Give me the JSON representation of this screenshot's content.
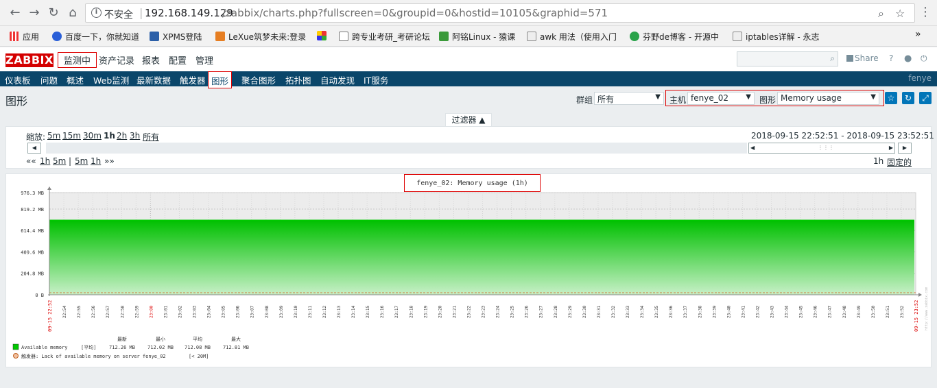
{
  "browser": {
    "back_icon": "←",
    "forward_icon": "→",
    "reload_icon": "↻",
    "home_icon": "⌂",
    "insecure_label": "不安全",
    "url_host": "192.168.149.129",
    "url_path": "/zabbix/charts.php?fullscreen=0&groupid=0&hostid=10105&graphid=571",
    "bookmarks": [
      "应用",
      "百度一下，你就知道",
      "XPMS登陆",
      "LeXue筑梦未来:登录",
      "跨专业考研_考研论坛",
      "阿铭Linux - 猿课",
      "awk 用法（使用入门",
      "芬野de博客 - 开源中",
      "iptables详解 - 永志"
    ],
    "more_bookmarks": "»"
  },
  "header": {
    "logo": "ZABBIX",
    "menu": [
      "监测中",
      "资产记录",
      "报表",
      "配置",
      "管理"
    ],
    "share_label": "Share",
    "help": "?",
    "search_value": ""
  },
  "subnav": {
    "items": [
      "仪表板",
      "问题",
      "概述",
      "Web监测",
      "最新数据",
      "触发器",
      "图形",
      "聚合图形",
      "拓扑图",
      "自动发现",
      "IT服务"
    ],
    "user": "fenye"
  },
  "page": {
    "title": "图形",
    "group_label": "群组",
    "group_value": "所有",
    "host_label": "主机",
    "host_value": "fenye_02",
    "graph_label": "图形",
    "graph_value": "Memory usage"
  },
  "filter": {
    "tab_label": "过滤器 ▲",
    "zoom_label": "缩放:",
    "zoom_options": [
      "5m",
      "15m",
      "30m",
      "1h",
      "2h",
      "3h",
      "所有"
    ],
    "period": "2018-09-15 22:52:51 - 2018-09-15 23:52:51",
    "nav_prev_all": "««",
    "nav_steps": [
      "1h",
      "5m",
      "|",
      "5m",
      "1h"
    ],
    "nav_next_all": "»»",
    "duration": "1h",
    "fixed_label": "固定的"
  },
  "chart_data": {
    "type": "area",
    "title": "fenye_02: Memory usage (1h)",
    "y_tick_labels": [
      "976.3 MB",
      "819.2 MB",
      "614.4 MB",
      "409.6 MB",
      "204.8 MB",
      "0 B"
    ],
    "y_ticks_mb": [
      976.3,
      819.2,
      614.4,
      409.6,
      204.8,
      0
    ],
    "ylim_mb": [
      0,
      976.3
    ],
    "start_label": "09-15 22:52",
    "end_label": "09-15 23:52",
    "x_tick_labels": [
      "22:54",
      "22:55",
      "22:56",
      "22:57",
      "22:58",
      "22:59",
      "23:00",
      "23:01",
      "23:02",
      "23:03",
      "23:04",
      "23:05",
      "23:06",
      "23:07",
      "23:08",
      "23:09",
      "23:10",
      "23:11",
      "23:12",
      "23:13",
      "23:14",
      "23:15",
      "23:16",
      "23:17",
      "23:18",
      "23:19",
      "23:20",
      "23:21",
      "23:22",
      "23:23",
      "23:24",
      "23:25",
      "23:26",
      "23:27",
      "23:28",
      "23:29",
      "23:30",
      "23:31",
      "23:32",
      "23:33",
      "23:34",
      "23:35",
      "23:36",
      "23:37",
      "23:38",
      "23:39",
      "23:40",
      "23:41",
      "23:42",
      "23:43",
      "23:44",
      "23:45",
      "23:46",
      "23:47",
      "23:48",
      "23:49",
      "23:50",
      "23:51",
      "23:52"
    ],
    "series": [
      {
        "name": "Available memory",
        "color": "#00C800",
        "value_mb": 712.26
      }
    ],
    "trigger_threshold_mb": 20,
    "legend": {
      "headers": [
        "最新",
        "最小",
        "平均",
        "最大"
      ],
      "rows": [
        {
          "label": "Available memory",
          "agg": "[平均]",
          "last": "712.26 MB",
          "min": "712.02 MB",
          "avg": "712.08 MB",
          "max": "712.81 MB"
        }
      ],
      "trigger": {
        "label": "触发器: Lack of available memory on server fenye_02",
        "value": "[< 20M]"
      }
    },
    "watermark": "http://www.zabbix.com"
  }
}
